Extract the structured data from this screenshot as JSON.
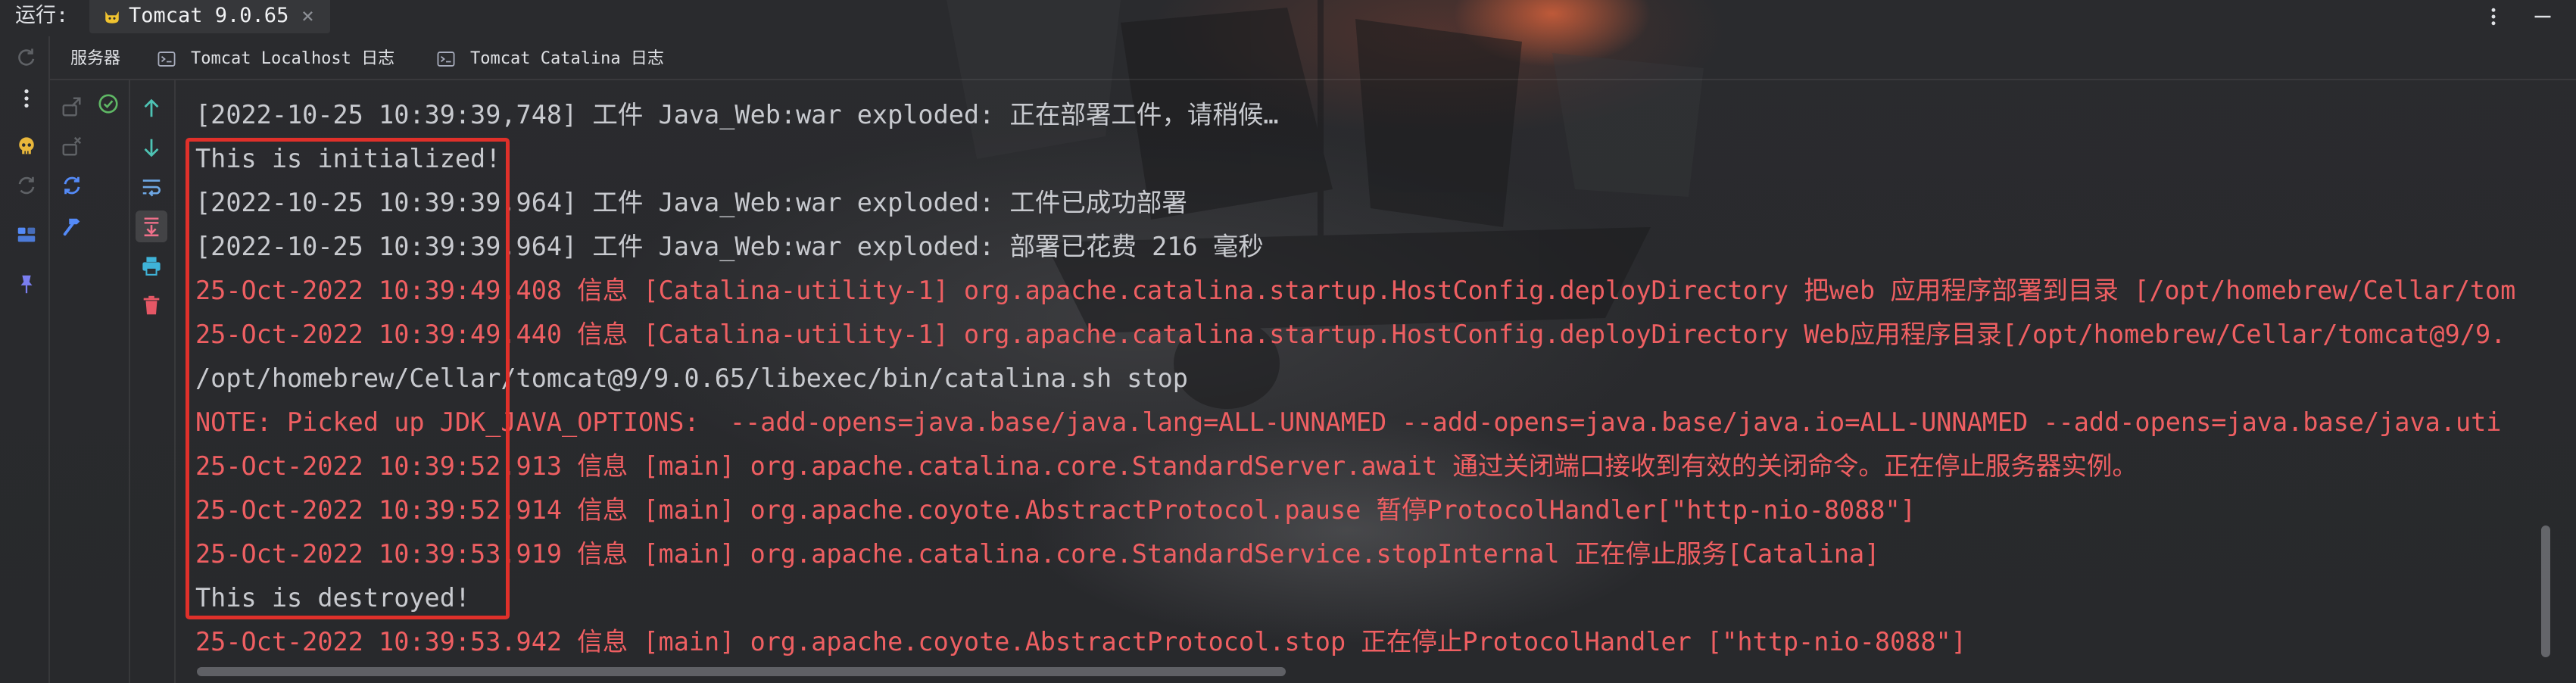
{
  "window": {
    "run_label": "运行:",
    "run_tab": {
      "title": "Tomcat 9.0.65",
      "close": "×",
      "icon": "tomcat-icon"
    },
    "actions": [
      {
        "icon": "more-vertical-icon"
      },
      {
        "icon": "minimize-icon"
      }
    ]
  },
  "tabs": [
    {
      "label": "服务器",
      "selected": true
    },
    {
      "label": "Tomcat Localhost 日志",
      "icon": "console-log-icon"
    },
    {
      "label": "Tomcat Catalina 日志",
      "icon": "console-log-icon"
    }
  ],
  "left_toolbar": [
    {
      "icon": "rerun-icon",
      "enabled": false
    },
    {
      "icon": "more-vertical-icon",
      "enabled": true
    },
    {
      "icon": "skull-icon",
      "enabled": true
    },
    {
      "icon": "restart-icon",
      "enabled": false
    },
    {
      "icon": "layout-icon",
      "enabled": true
    },
    {
      "icon": "pin-icon",
      "enabled": true
    }
  ],
  "services_toolbar": [
    {
      "icon": "deploy-icon",
      "enabled": false
    },
    {
      "icon": "check-circle-icon",
      "enabled": true
    },
    {
      "icon": "undeploy-icon",
      "enabled": false
    },
    {
      "icon": "refresh-icon",
      "enabled": true
    },
    {
      "icon": "hammer-icon",
      "enabled": true
    }
  ],
  "console_toolbar": [
    {
      "icon": "arrow-up-icon"
    },
    {
      "icon": "arrow-down-icon"
    },
    {
      "icon": "soft-wrap-icon"
    },
    {
      "icon": "scroll-to-end-icon",
      "active": true
    },
    {
      "icon": "print-icon"
    },
    {
      "icon": "trash-icon"
    }
  ],
  "console": {
    "lines": [
      {
        "stream": "stdout",
        "text": "[2022-10-25 10:39:39,748] 工件 Java_Web:war exploded: 正在部署工件，请稍候…"
      },
      {
        "stream": "stdout",
        "text": "This is initialized!"
      },
      {
        "stream": "stdout",
        "text": "[2022-10-25 10:39:39,964] 工件 Java_Web:war exploded: 工件已成功部署"
      },
      {
        "stream": "stdout",
        "text": "[2022-10-25 10:39:39,964] 工件 Java_Web:war exploded: 部署已花费 216 毫秒"
      },
      {
        "stream": "stderr",
        "text": "25-Oct-2022 10:39:49.408 信息 [Catalina-utility-1] org.apache.catalina.startup.HostConfig.deployDirectory 把web 应用程序部署到目录 [/opt/homebrew/Cellar/tom"
      },
      {
        "stream": "stderr",
        "text": "25-Oct-2022 10:39:49.440 信息 [Catalina-utility-1] org.apache.catalina.startup.HostConfig.deployDirectory Web应用程序目录[/opt/homebrew/Cellar/tomcat@9/9."
      },
      {
        "stream": "stdout",
        "text": "/opt/homebrew/Cellar/tomcat@9/9.0.65/libexec/bin/catalina.sh stop"
      },
      {
        "stream": "stderr",
        "text": "NOTE: Picked up JDK_JAVA_OPTIONS:  --add-opens=java.base/java.lang=ALL-UNNAMED --add-opens=java.base/java.io=ALL-UNNAMED --add-opens=java.base/java.uti"
      },
      {
        "stream": "stderr",
        "text": "25-Oct-2022 10:39:52.913 信息 [main] org.apache.catalina.core.StandardServer.await 通过关闭端口接收到有效的关闭命令。正在停止服务器实例。"
      },
      {
        "stream": "stderr",
        "text": "25-Oct-2022 10:39:52.914 信息 [main] org.apache.coyote.AbstractProtocol.pause 暂停ProtocolHandler[\"http-nio-8088\"]"
      },
      {
        "stream": "stderr",
        "text": "25-Oct-2022 10:39:53.919 信息 [main] org.apache.catalina.core.StandardService.stopInternal 正在停止服务[Catalina]"
      },
      {
        "stream": "stdout",
        "text": "This is destroyed!"
      },
      {
        "stream": "stderr",
        "text": "25-Oct-2022 10:39:53.942 信息 [main] org.apache.coyote.AbstractProtocol.stop 正在停止ProtocolHandler [\"http-nio-8088\"]"
      }
    ]
  },
  "colors": {
    "stdout_text": "#c8cacf",
    "stderr_text": "#ef5f62",
    "highlight_box": "#e0302a",
    "accent_blue": "#548af7",
    "success_green": "#5fb865",
    "warning_yellow": "#e9b73b",
    "arrow_teal": "#4ec3b4",
    "danger_red": "#e55765",
    "print_cyan": "#3fb3d8"
  }
}
